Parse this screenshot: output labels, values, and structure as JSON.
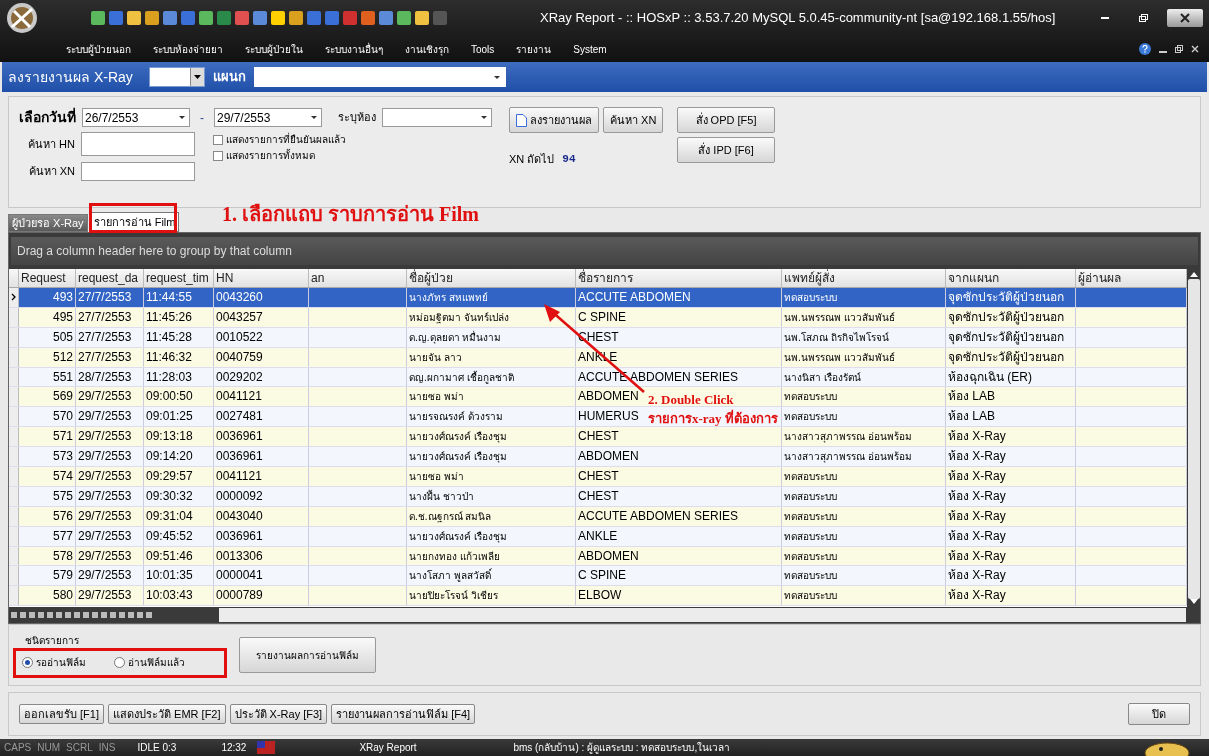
{
  "window": {
    "title": "XRay Report - :: HOSxP :: 3.53.7.20 MySQL 5.0.45-community-nt [sa@192.168.1.55/hos]"
  },
  "menu": [
    "ระบบผู้ป่วยนอก",
    "ระบบห้องจ่ายยา",
    "ระบบผู้ป่วยใน",
    "ระบบงานอื่นๆ",
    "งานเชิงรุก",
    "Tools",
    "รายงาน",
    "System"
  ],
  "header": {
    "title": "ลงรายงานผล X-Ray",
    "department_label": "แผนก"
  },
  "filters": {
    "date_label": "เลือกวันที่",
    "date_from": "26/7/2553",
    "date_sep": "-",
    "date_to": "29/7/2553",
    "room_label": "ระบุห้อง",
    "hn_label": "ค้นหา HN",
    "xn_label": "ค้นหา XN",
    "checkboxes": [
      {
        "label": "แสดงรายการที่ยืนยันผลแล้ว",
        "checked": false
      },
      {
        "label": "แสดงรายการทั้งหมด",
        "checked": false
      }
    ],
    "next_xn_label": "XN ถัดไป",
    "next_xn": "94",
    "buttons": [
      {
        "label": "ลงรายงานผล",
        "kind": "icon"
      },
      {
        "label": "ค้นหา XN",
        "kind": "plain"
      },
      {
        "label": "สั่ง OPD [F5]",
        "kind": "plain"
      },
      {
        "label": "สั่ง IPD [F6]",
        "kind": "plain"
      }
    ]
  },
  "tabs": [
    {
      "label": "ผู้ป่วยรอ X-Ray",
      "selected": false
    },
    {
      "label": "รายการอ่าน Film",
      "selected": true
    }
  ],
  "annotations": [
    "1. เลือกแถบ ราบการอ่าน Film",
    "2. Double Click รายการx-ray ที่ต้องการ"
  ],
  "grid": {
    "group_hint": "Drag a column header here to group by that column",
    "columns": [
      "Request",
      "request_da",
      "request_tim",
      "HN",
      "an",
      "ชื่อผู้ป่วย",
      "ชื่อรายการ",
      "แพทย์ผู้สั่ง",
      "จากแผนก",
      "ผู้อ่านผล"
    ],
    "rows": [
      {
        "selected": true,
        "cells": [
          "493",
          "27/7/2553",
          "11:44:55",
          "0043260",
          "",
          "นางภัทร สหแพทย์",
          "ACCUTE ABDOMEN",
          "ทดสอบระบบ",
          "จุดซักประวัติผู้ป่วยนอก",
          ""
        ]
      },
      {
        "selected": false,
        "cells": [
          "495",
          "27/7/2553",
          "11:45:26",
          "0043257",
          "",
          "หม่อมฐิตมา จันทร์เปล่ง",
          "C SPINE",
          "นพ.นพรรณพ แววสัมพันธ์",
          "จุดซักประวัติผู้ป่วยนอก",
          ""
        ]
      },
      {
        "selected": false,
        "cells": [
          "505",
          "27/7/2553",
          "11:45:28",
          "0010522",
          "",
          "ด.ญ.ดุลยดา หมื่นงาม",
          "CHEST",
          "นพ.โสภณ ถิรกิจไพโรจน์",
          "จุดซักประวัติผู้ป่วยนอก",
          ""
        ]
      },
      {
        "selected": false,
        "cells": [
          "512",
          "27/7/2553",
          "11:46:32",
          "0040759",
          "",
          "นายจัน ลาว",
          "ANKLE",
          "นพ.นพรรณพ แววสัมพันธ์",
          "จุดซักประวัติผู้ป่วยนอก",
          ""
        ]
      },
      {
        "selected": false,
        "cells": [
          "551",
          "28/7/2553",
          "11:28:03",
          "0029202",
          "",
          "ดญ.ผกามาศ เชื้อกูลชาติ",
          "ACCUTE ABDOMEN SERIES",
          "นางนิสา เรืองรัตน์",
          "ห้องฉุกเฉิน (ER)",
          ""
        ]
      },
      {
        "selected": false,
        "cells": [
          "569",
          "29/7/2553",
          "09:00:50",
          "0041121",
          "",
          "นายซอ พม่า",
          "ABDOMEN",
          "ทดสอบระบบ",
          "ห้อง LAB",
          ""
        ]
      },
      {
        "selected": false,
        "cells": [
          "570",
          "29/7/2553",
          "09:01:25",
          "0027481",
          "",
          "นายรจณรงค์ ด้วงราม",
          "HUMERUS",
          "ทดสอบระบบ",
          "ห้อง LAB",
          ""
        ]
      },
      {
        "selected": false,
        "cells": [
          "571",
          "29/7/2553",
          "09:13:18",
          "0036961",
          "",
          "นายวงศ์ณรงค์ เรืองชุม",
          "CHEST",
          "นางสาวสุภาพรรณ อ่อนพร้อม",
          "ห้อง X-Ray",
          ""
        ]
      },
      {
        "selected": false,
        "cells": [
          "573",
          "29/7/2553",
          "09:14:20",
          "0036961",
          "",
          "นายวงศ์ณรงค์ เรืองชุม",
          "ABDOMEN",
          "นางสาวสุภาพรรณ อ่อนพร้อม",
          "ห้อง X-Ray",
          ""
        ]
      },
      {
        "selected": false,
        "cells": [
          "574",
          "29/7/2553",
          "09:29:57",
          "0041121",
          "",
          "นายซอ พม่า",
          "CHEST",
          "ทดสอบระบบ",
          "ห้อง X-Ray",
          ""
        ]
      },
      {
        "selected": false,
        "cells": [
          "575",
          "29/7/2553",
          "09:30:32",
          "0000092",
          "",
          "นางฝึ้น ชาวป่า",
          "CHEST",
          "ทดสอบระบบ",
          "ห้อง X-Ray",
          ""
        ]
      },
      {
        "selected": false,
        "cells": [
          "576",
          "29/7/2553",
          "09:31:04",
          "0043040",
          "",
          "ด.ช.ณฐกรณ์ สมนิล",
          "ACCUTE ABDOMEN SERIES",
          "ทดสอบระบบ",
          "ห้อง X-Ray",
          ""
        ]
      },
      {
        "selected": false,
        "cells": [
          "577",
          "29/7/2553",
          "09:45:52",
          "0036961",
          "",
          "นายวงศ์ณรงค์ เรืองชุม",
          "ANKLE",
          "ทดสอบระบบ",
          "ห้อง X-Ray",
          ""
        ]
      },
      {
        "selected": false,
        "cells": [
          "578",
          "29/7/2553",
          "09:51:46",
          "0013306",
          "",
          "นายกงทอง แก้วเพลีย",
          "ABDOMEN",
          "ทดสอบระบบ",
          "ห้อง X-Ray",
          ""
        ]
      },
      {
        "selected": false,
        "cells": [
          "579",
          "29/7/2553",
          "10:01:35",
          "0000041",
          "",
          "นางโสภา พูลสวัสดิ์",
          "C SPINE",
          "ทดสอบระบบ",
          "ห้อง X-Ray",
          ""
        ]
      },
      {
        "selected": false,
        "cells": [
          "580",
          "29/7/2553",
          "10:03:43",
          "0000789",
          "",
          "นายปิยะโรจน์ วิเชียร",
          "ELBOW",
          "ทดสอบระบบ",
          "ห้อง X-Ray",
          ""
        ]
      }
    ]
  },
  "list_type": {
    "label": "ชนิดรายการ",
    "options": [
      {
        "label": "รออ่านฟิล์ม",
        "selected": true
      },
      {
        "label": "อ่านฟิล์มแล้ว",
        "selected": false
      }
    ],
    "report_button": "รายงานผลการอ่านฟิล์ม"
  },
  "bottom_buttons": [
    "ออกเลขรับ [F1]",
    "แสดงประวัติ EMR [F2]",
    "ประวัติ X-Ray [F3]",
    "รายงานผลการอ่านฟิล์ม [F4]"
  ],
  "close_button": "ปิด",
  "status_bar": [
    "CAPS",
    "NUM",
    "SCRL",
    "INS",
    "IDLE 0:3",
    "12:32",
    "XRay Report",
    "bms (กลับบ้าน) : ผู้ดูแลระบบ : ทดสอบระบบ,ในเวลา"
  ]
}
